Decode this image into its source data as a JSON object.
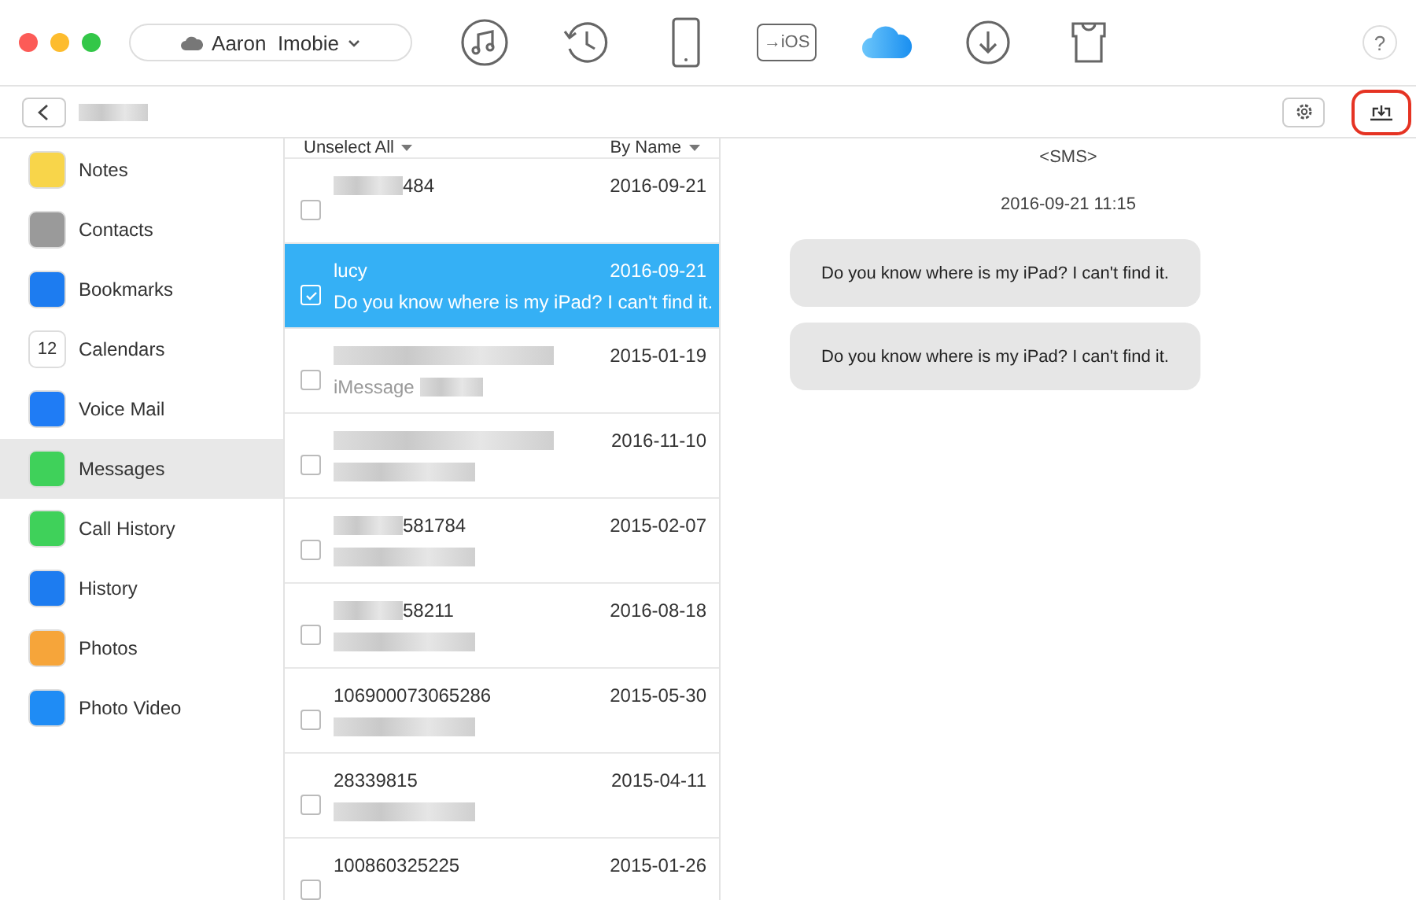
{
  "device": {
    "name": "Aaron  Imobie"
  },
  "toolbar_icons": [
    {
      "kind": "music",
      "selected": false
    },
    {
      "kind": "history",
      "selected": false
    },
    {
      "kind": "phone",
      "selected": false
    },
    {
      "kind": "ios",
      "label": "→iOS",
      "selected": false
    },
    {
      "kind": "cloud",
      "selected": true
    },
    {
      "kind": "download",
      "selected": false
    },
    {
      "kind": "shirt",
      "selected": false
    }
  ],
  "help": "?",
  "sidebar": {
    "items": [
      {
        "label": "Notes",
        "kind": "notes",
        "selected": false
      },
      {
        "label": "Contacts",
        "kind": "contacts",
        "selected": false
      },
      {
        "label": "Bookmarks",
        "kind": "bookmarks",
        "selected": false
      },
      {
        "label": "Calendars",
        "kind": "calendar",
        "icon_text": "12",
        "selected": false
      },
      {
        "label": "Voice Mail",
        "kind": "voicemail",
        "selected": false
      },
      {
        "label": "Messages",
        "kind": "messages",
        "selected": true
      },
      {
        "label": "Call History",
        "kind": "call",
        "selected": false
      },
      {
        "label": "History",
        "kind": "clock",
        "selected": false
      },
      {
        "label": "Photos",
        "kind": "photos",
        "selected": false
      },
      {
        "label": "Photo Video",
        "kind": "video",
        "selected": false
      }
    ]
  },
  "list": {
    "select_label": "Unselect All",
    "sort_label": "By Name",
    "rows": [
      {
        "name": "484",
        "name_redacted": true,
        "date": "2016-09-21",
        "preview": "",
        "preview_redacted": false,
        "checked": false,
        "selected": false
      },
      {
        "name": "lucy",
        "name_redacted": false,
        "date": "2016-09-21",
        "preview": "Do you know where is my iPad? I can't find it.",
        "preview_redacted": false,
        "checked": true,
        "selected": true
      },
      {
        "name": "",
        "name_redacted": true,
        "date": "2015-01-19",
        "preview": "iMessage",
        "preview_redacted": true,
        "checked": false,
        "selected": false
      },
      {
        "name": "",
        "name_redacted": true,
        "date": "2016-11-10",
        "preview": "",
        "preview_redacted": true,
        "checked": false,
        "selected": false
      },
      {
        "name": "581784",
        "name_redacted": true,
        "date": "2015-02-07",
        "preview": "",
        "preview_redacted": true,
        "checked": false,
        "selected": false
      },
      {
        "name": "58211",
        "name_redacted": true,
        "date": "2016-08-18",
        "preview": "",
        "preview_redacted": true,
        "checked": false,
        "selected": false
      },
      {
        "name": "106900073065286",
        "name_redacted": false,
        "date": "2015-05-30",
        "preview": "",
        "preview_redacted": true,
        "checked": false,
        "selected": false
      },
      {
        "name": "28339815",
        "name_redacted": false,
        "date": "2015-04-11",
        "preview": "",
        "preview_redacted": true,
        "checked": false,
        "selected": false
      },
      {
        "name": "100860325225",
        "name_redacted": false,
        "date": "2015-01-26",
        "preview": "",
        "preview_redacted": false,
        "checked": false,
        "selected": false
      }
    ]
  },
  "detail": {
    "title": "<SMS>",
    "timestamp": "2016-09-21 11:15",
    "messages": [
      "Do you know where is my iPad? I can't find it.",
      "Do you know where is my iPad? I can't find it."
    ]
  },
  "export_highlighted": true
}
